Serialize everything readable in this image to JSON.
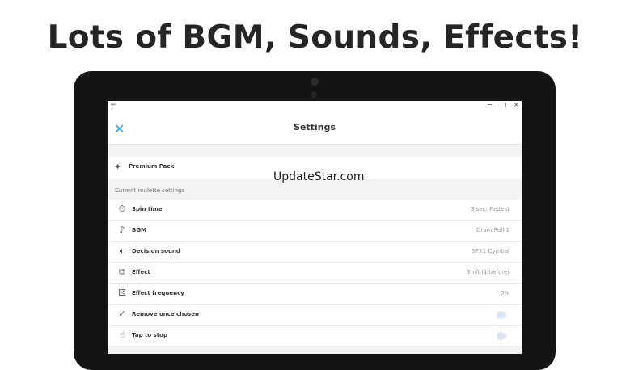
{
  "headline": "Lots of BGM, Sounds, Effects!",
  "watermark": "UpdateStar.com",
  "window": {
    "back_icon": "back-arrow-icon",
    "minimize_symbol": "−",
    "maximize_symbol": "□",
    "close_symbol": "×"
  },
  "appbar": {
    "title": "Settings",
    "close_icon": "close-icon",
    "accent_color": "#29a3d9"
  },
  "premium": {
    "label": "Premium Pack",
    "icon": "sparkle-icon"
  },
  "roulette": {
    "section_title": "Current roulette settings",
    "items": [
      {
        "label": "Spin time",
        "value": "3 sec: Fastest",
        "icon": "timer-icon"
      },
      {
        "label": "BGM",
        "value": "Drum Roll 1",
        "icon": "music-note-icon"
      },
      {
        "label": "Decision sound",
        "value": "SFX1 Cymbal",
        "icon": "speaker-icon"
      },
      {
        "label": "Effect",
        "value": "Shift (1 before)",
        "icon": "effect-icon"
      },
      {
        "label": "Effect frequency",
        "value": "0%",
        "icon": "dice-icon"
      },
      {
        "label": "Remove once chosen",
        "toggle": false,
        "icon": "check-circle-icon"
      },
      {
        "label": "Tap to stop",
        "toggle": false,
        "icon": "tap-icon"
      }
    ]
  }
}
